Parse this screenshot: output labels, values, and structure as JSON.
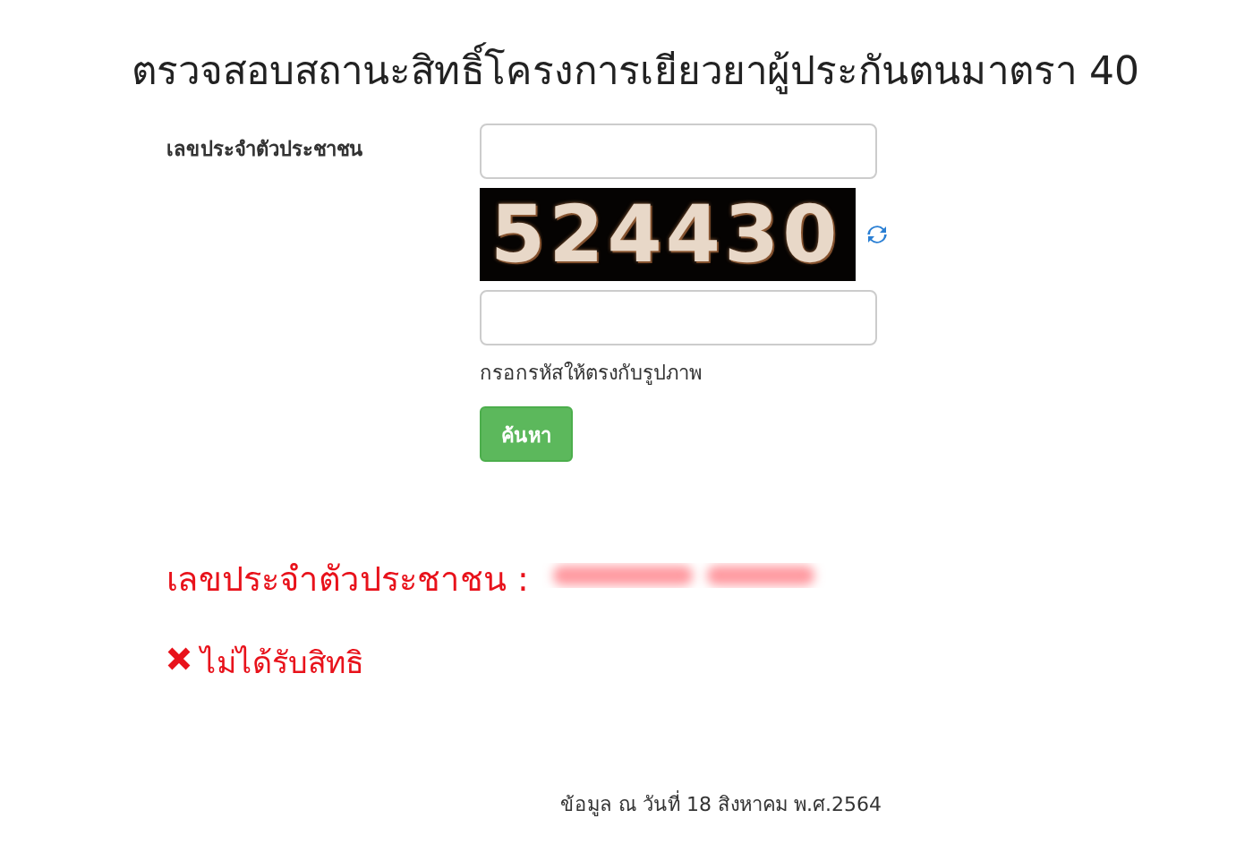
{
  "title": "ตรวจสอบสถานะสิทธิ์โครงการเยียวยาผู้ประกันตนมาตรา 40",
  "form": {
    "id_label": "เลขประจำตัวประชาชน",
    "captcha": "524430",
    "captcha_hint": "กรอกรหัสให้ตรงกับรูปภาพ",
    "search_button": "ค้นหา"
  },
  "result": {
    "id_label": "เลขประจำตัวประชาชน :",
    "id_redacted": true,
    "eligible": false,
    "status": "ไม่ได้รับสิทธิ"
  },
  "footer": "ข้อมูล ณ วันที่ 18 สิงหาคม พ.ศ.2564"
}
